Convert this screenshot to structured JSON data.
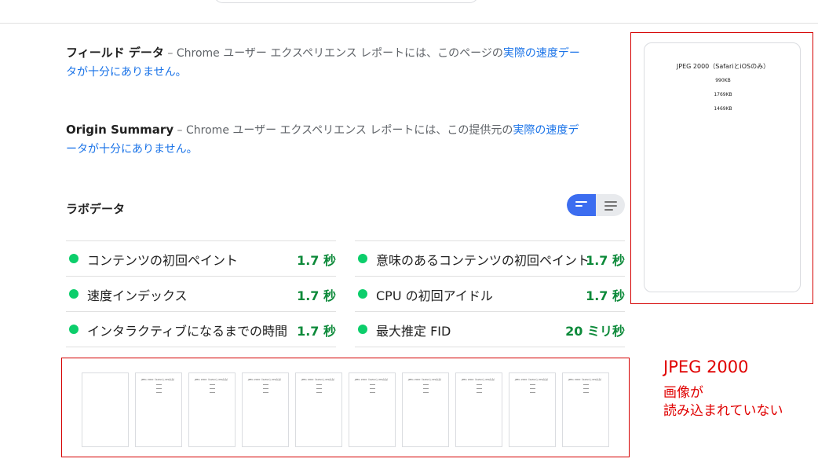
{
  "field_data": {
    "title": "フィールド データ",
    "dash": " – ",
    "body_prefix": "Chrome ユーザー エクスペリエンス レポートには、このページの",
    "link": "実際の速度データが十分にありません。"
  },
  "origin_summary": {
    "title": "Origin Summary",
    "dash": " – ",
    "body_prefix": "Chrome ユーザー エクスペリエンス レポートには、この提供元の",
    "link": "実際の速度データが十分にありません。"
  },
  "lab_data": {
    "title": "ラボデータ",
    "metrics": [
      {
        "label": "コンテンツの初回ペイント",
        "value": "1.7 秒"
      },
      {
        "label": "意味のあるコンテンツの初回ペイント",
        "value": "1.7 秒"
      },
      {
        "label": "速度インデックス",
        "value": "1.7 秒"
      },
      {
        "label": "CPU の初回アイドル",
        "value": "1.7 秒"
      },
      {
        "label": "インタラクティブになるまでの時間",
        "value": "1.7 秒"
      },
      {
        "label": "最大推定 FID",
        "value": "20 ミリ秒"
      }
    ]
  },
  "preview": {
    "title": "JPEG 2000（SafariとiOSのみ）",
    "sizes": [
      "990KB",
      "1769KB",
      "1469KB"
    ]
  },
  "filmstrip": {
    "frame_count": 10,
    "frame_title": "JPEG 2000（SafariとiOSのみ）"
  },
  "annotation": {
    "line1": "JPEG 2000",
    "line2a": "画像が",
    "line2b": "読み込まれていない"
  },
  "colors": {
    "pass_green": "#0cce6b",
    "value_green": "#0d8a3a",
    "link_blue": "#1a73e8",
    "toggle_active": "#3c6df0",
    "annotation_red": "#d50000"
  }
}
